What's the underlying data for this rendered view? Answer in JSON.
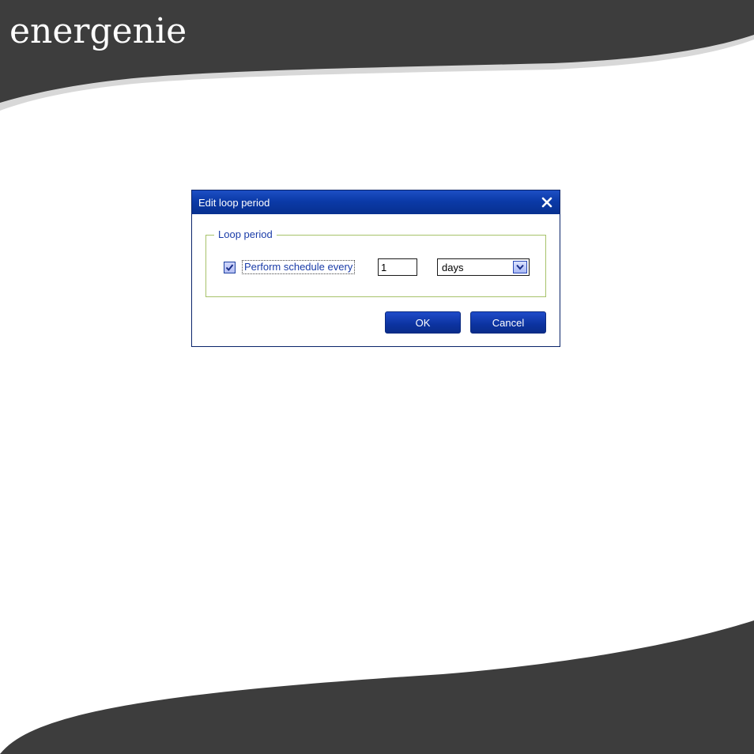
{
  "brand": {
    "logo_text": "energenie"
  },
  "dialog": {
    "title": "Edit loop period",
    "group_label": "Loop period",
    "checkbox": {
      "label": "Perform schedule every",
      "checked": true
    },
    "interval_value": "1",
    "unit_select": {
      "selected": "days"
    },
    "ok_label": "OK",
    "cancel_label": "Cancel"
  },
  "colors": {
    "banner": "#3d3d3d",
    "titlebar": "#0b3aa8",
    "group_border": "#a7c26a",
    "label_text": "#1a3ca8"
  },
  "icons": [
    "close-icon",
    "checkmark-icon",
    "chevron-down-icon"
  ]
}
